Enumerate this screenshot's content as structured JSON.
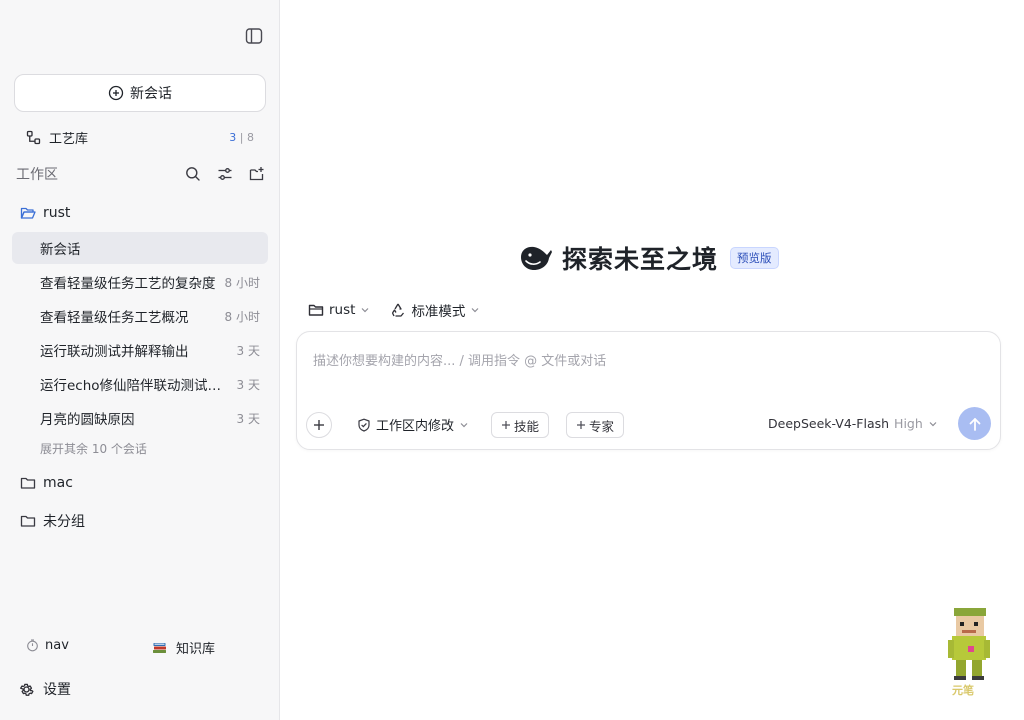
{
  "sidebar": {
    "new_chat_label": "新会话",
    "craft": {
      "label": "工艺库",
      "count_active": "3",
      "count_sep": " | ",
      "count_total": "8"
    },
    "workspace_title": "工作区",
    "folders": [
      {
        "name": "rust"
      },
      {
        "name": "mac"
      },
      {
        "name": "未分组"
      }
    ],
    "chats": [
      {
        "title": "新会话",
        "time": ""
      },
      {
        "title": "查看轻量级任务工艺的复杂度",
        "time": "8 小时"
      },
      {
        "title": "查看轻量级任务工艺概况",
        "time": "8 小时"
      },
      {
        "title": "运行联动测试并解释输出",
        "time": "3 天"
      },
      {
        "title": "运行echo修仙陪伴联动测试脚本",
        "time": "3 天"
      },
      {
        "title": "月亮的圆缺原因",
        "time": "3 天"
      }
    ],
    "expand_more": "展开其余 10 个会话",
    "bottom": {
      "nav_label": "nav",
      "kb_label": "知识库",
      "settings_label": "设置"
    }
  },
  "main": {
    "hero_title": "探索未至之境",
    "hero_badge": "预览版",
    "project_selector": "rust",
    "mode_selector": "标准模式",
    "composer": {
      "placeholder": "描述你想要构建的内容... / 调用指令 @ 文件或对话",
      "permission_label": "工作区内修改",
      "skill_label": "技能",
      "expert_label": "专家",
      "model_name": "DeepSeek-V4-Flash",
      "model_level": "High"
    }
  },
  "mascot_label": "元笔",
  "colors": {
    "accent": "#3b6fd6",
    "send_button": "#a9bdf2",
    "active_row": "#e8e9ee",
    "badge_bg": "#e4ebff"
  }
}
